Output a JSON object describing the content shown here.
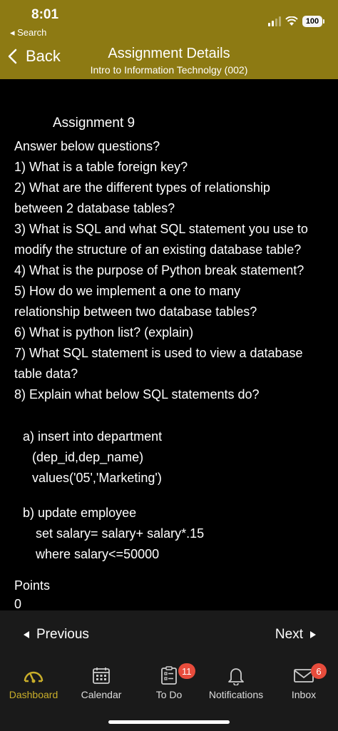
{
  "status": {
    "time": "8:01",
    "back_app": "◂ Search",
    "battery": "100"
  },
  "header": {
    "back_label": "Back",
    "title": "Assignment Details",
    "subtitle": "Intro to Information Technolgy (002)"
  },
  "assignment": {
    "title": "Assignment 9",
    "lines": [
      "Answer below questions?",
      "1) What is a table foreign key?",
      "2) What are the different types of relationship",
      "between 2 database tables?",
      "3) What is SQL and what SQL statement you use to",
      "modify the structure of an existing database table?",
      "4) What is the purpose of Python break statement?",
      "5) How do we implement a one to many",
      "relationship between two database tables?",
      "6) What is python list? (explain)",
      "7) What SQL statement is used to view a database",
      "table data?",
      "8) Explain what below SQL statements do?"
    ],
    "sql_a": {
      "line1": "a)  insert into department",
      "line2": "(dep_id,dep_name)",
      "line3": "values('05','Marketing')"
    },
    "sql_b": {
      "line1": "b)  update employee",
      "line2": "set salary= salary+ salary*.15",
      "line3": "where salary<=50000"
    },
    "points_label": "Points",
    "points_value": "0"
  },
  "nav": {
    "previous_label": "Previous",
    "next_label": "Next"
  },
  "tabs": {
    "dashboard": "Dashboard",
    "calendar": "Calendar",
    "todo": "To Do",
    "todo_badge": "11",
    "notifications": "Notifications",
    "inbox": "Inbox",
    "inbox_badge": "6"
  },
  "colors": {
    "header_bg": "#8d7a13",
    "active_tab": "#c9ae2a",
    "badge": "#e74c3c"
  }
}
